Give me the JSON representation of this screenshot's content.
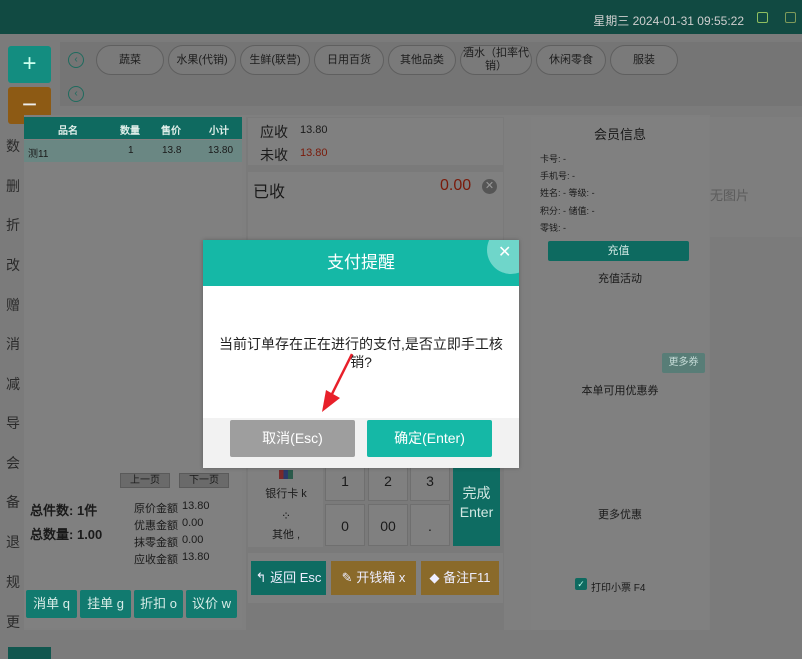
{
  "topbar": {
    "datetime": "星期三 2024-01-31 09:55:22"
  },
  "sidebar": {
    "add": "+",
    "remove": "−",
    "items": [
      "数",
      "删",
      "折",
      "改",
      "赠",
      "消",
      "减",
      "导",
      "会",
      "备",
      "退",
      "规",
      "更"
    ]
  },
  "categories": [
    "蔬菜",
    "水果(代销)",
    "生鲜(联营)",
    "日用百货",
    "其他品类",
    "酒水（扣率代销）",
    "休闲零食",
    "服装"
  ],
  "order_table": {
    "headers": [
      "品名",
      "数量",
      "售价",
      "小计"
    ],
    "rows": [
      {
        "name": "测11",
        "qty": "1",
        "price": "13.8",
        "subtotal": "13.80"
      }
    ],
    "prev_page": "上一页",
    "next_page": "下一页"
  },
  "summary": {
    "total_items_label": "总件数:",
    "total_items": "1件",
    "total_qty_label": "总数量:",
    "total_qty": "1.00",
    "original_label": "原价金额",
    "original": "13.80",
    "discount_label": "优惠金额",
    "discount": "0.00",
    "rounding_label": "抹零金额",
    "rounding": "0.00",
    "receivable_label": "应收金额",
    "receivable": "13.80"
  },
  "left_buttons": [
    "消单 q",
    "挂单 g",
    "折扣 o",
    "议价 w"
  ],
  "payment": {
    "due_label": "应收",
    "due": "13.80",
    "unpaid_label": "未收",
    "unpaid": "13.80",
    "received_label": "已收",
    "received": "0.00",
    "methods": [
      {
        "label": "银行卡 k",
        "icon": "unionpay-icon"
      },
      {
        "label": "其他 ,",
        "icon": "grid-icon"
      }
    ],
    "keys": [
      "1",
      "2",
      "3",
      "0",
      "00",
      "."
    ],
    "finish": "完成 Enter",
    "actions": [
      "返回 Esc",
      "开钱箱 x",
      "备注F11"
    ]
  },
  "member": {
    "title": "会员信息",
    "card_label": "卡号:",
    "card": "-",
    "phone_label": "手机号:",
    "phone": "-",
    "name_label": "姓名:",
    "name": "-",
    "level_label": "等级:",
    "level": "-",
    "points_label": "积分:",
    "points": "-",
    "stored_label": "储值:",
    "stored": "-",
    "change_label": "零钱:",
    "change": "-",
    "recharge": "充值",
    "recharge_activity": "充值活动",
    "more_coupons": "更多券",
    "available_coupons": "本单可用优惠券",
    "more_offers": "更多优惠",
    "print_receipt": "打印小票 F4"
  },
  "behind_text": "无图片",
  "modal": {
    "title": "支付提醒",
    "message": "当前订单存在正在进行的支付,是否立即手工核销?",
    "cancel": "取消(Esc)",
    "confirm": "确定(Enter)"
  },
  "colors": {
    "accent": "#15b8a6",
    "cancel": "#9e9e9e",
    "amount_red": "#e03a1e",
    "arrow": "#e8202a"
  }
}
